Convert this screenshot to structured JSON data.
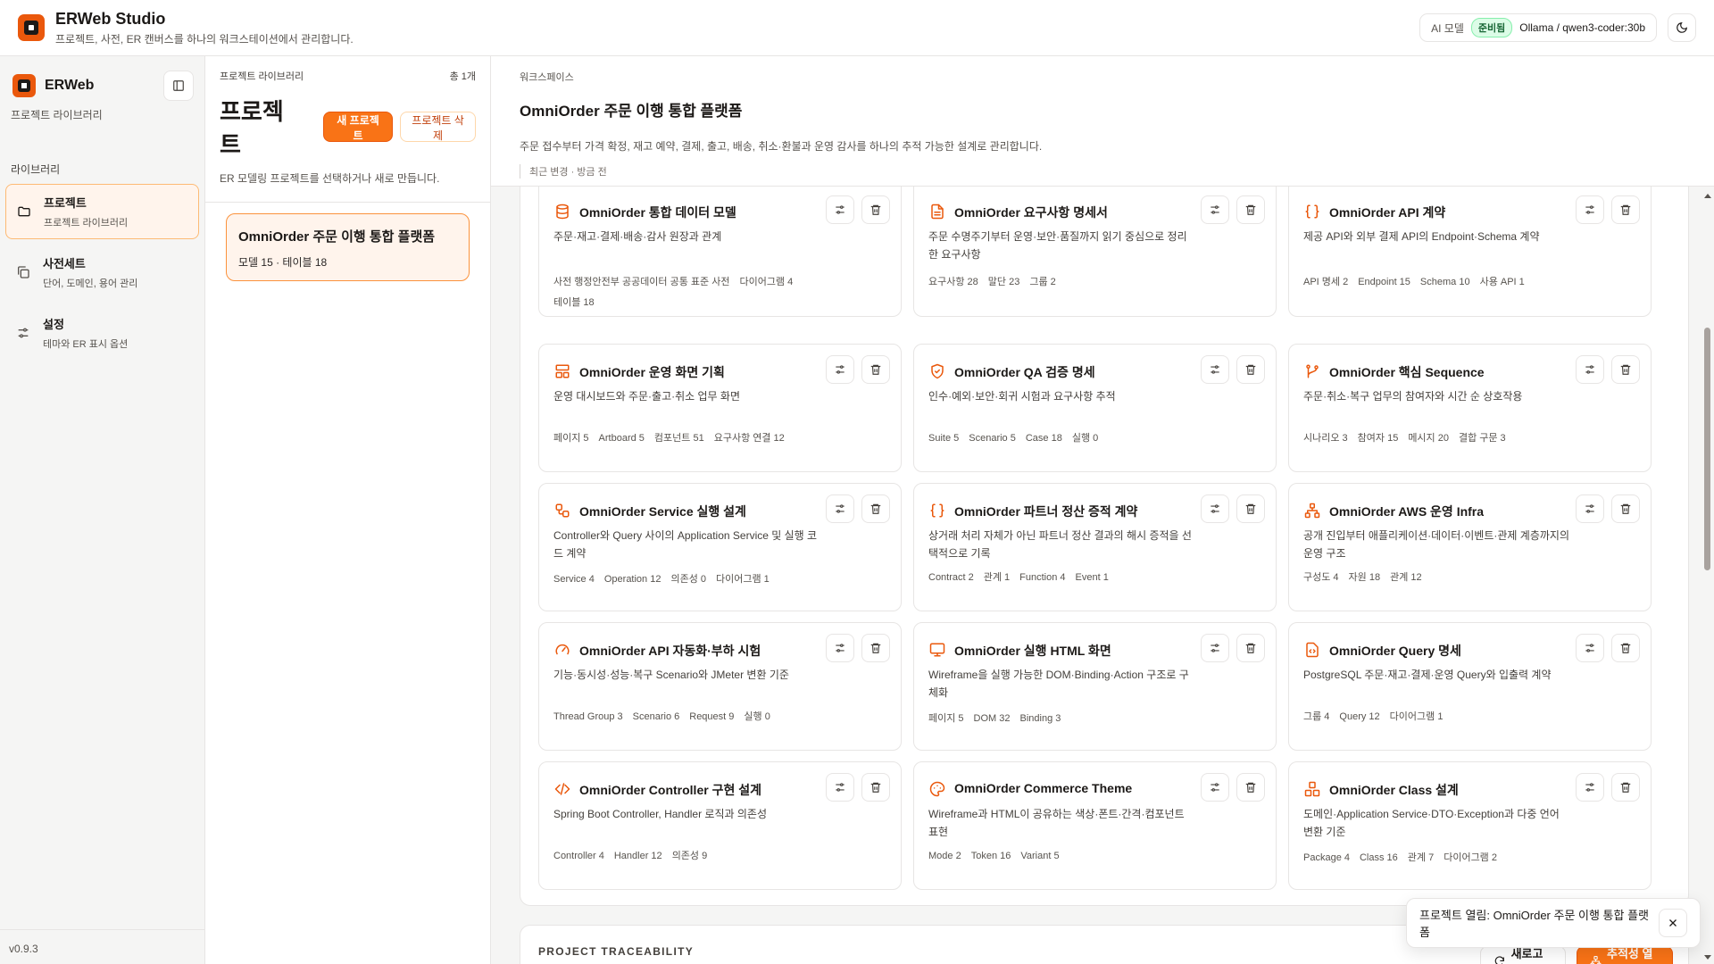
{
  "topbar": {
    "title": "ERWeb Studio",
    "subtitle": "프로젝트, 사전, ER 캔버스를 하나의 워크스테이션에서 관리합니다.",
    "ai_label": "AI 모델",
    "ai_status": "준비됨",
    "ai_model": "Ollama / qwen3-coder:30b"
  },
  "sidebar": {
    "brand": "ERWeb",
    "subtitle": "프로젝트 라이브러리",
    "section": "라이브러리",
    "items": [
      {
        "label": "프로젝트",
        "desc": "프로젝트 라이브러리",
        "active": true,
        "icon": "folder-icon"
      },
      {
        "label": "사전세트",
        "desc": "단어, 도메인, 용어 관리",
        "active": false,
        "icon": "copy-icon"
      },
      {
        "label": "설정",
        "desc": "테마와 ER 표시 옵션",
        "active": false,
        "icon": "sliders-icon"
      }
    ],
    "version": "v0.9.3"
  },
  "library": {
    "kicker": "프로젝트 라이브러리",
    "count": "총 1개",
    "title": "프로젝트",
    "new_button": "새 프로젝트",
    "delete_button": "프로젝트 삭제",
    "desc": "ER 모델링 프로젝트를 선택하거나 새로 만듭니다.",
    "projects": [
      {
        "name": "OmniOrder 주문 이행 통합 플랫폼",
        "meta": "모델 15 · 테이블 18"
      }
    ]
  },
  "workspace": {
    "kicker": "워크스페이스",
    "title": "OmniOrder 주문 이행 통합 플랫폼",
    "desc": "주문 접수부터 가격 확정, 재고 예약, 결제, 출고, 배송, 취소·환불과 운영 감사를 하나의 추적 가능한 설계로 관리합니다.",
    "meta": "최근 변경 · 방금 전",
    "cards": [
      {
        "icon": "database-icon",
        "title": "OmniOrder 통합 데이터 모델",
        "desc": "주문·재고·결제·배송·감사 원장과 관계",
        "stats": [
          "사전 행정안전부 공공데이터 공통 표준 사전",
          "다이어그램 4",
          "테이블 18"
        ]
      },
      {
        "icon": "document-icon",
        "title": "OmniOrder 요구사항 명세서",
        "desc": "주문 수명주기부터 운영·보안·품질까지 읽기 중심으로 정리한 요구사항",
        "stats": [
          "요구사항 28",
          "말단 23",
          "그룹 2"
        ]
      },
      {
        "icon": "braces-icon",
        "title": "OmniOrder API 계약",
        "desc": "제공 API와 외부 결제 API의 Endpoint·Schema 계약",
        "stats": [
          "API 명세 2",
          "Endpoint 15",
          "Schema 10",
          "사용 API 1"
        ]
      },
      {
        "icon": "layout-icon",
        "title": "OmniOrder 운영 화면 기획",
        "desc": "운영 대시보드와 주문·출고·취소 업무 화면",
        "stats": [
          "페이지 5",
          "Artboard 5",
          "컴포넌트 51",
          "요구사항 연결 12"
        ]
      },
      {
        "icon": "shield-check-icon",
        "title": "OmniOrder QA 검증 명세",
        "desc": "인수·예외·보안·회귀 시험과 요구사항 추적",
        "stats": [
          "Suite 5",
          "Scenario 5",
          "Case 18",
          "실행 0"
        ]
      },
      {
        "icon": "git-branch-icon",
        "title": "OmniOrder 핵심 Sequence",
        "desc": "주문·취소·복구 업무의 참여자와 시간 순 상호작용",
        "stats": [
          "시나리오 3",
          "참여자 15",
          "메시지 20",
          "결합 구문 3"
        ]
      },
      {
        "icon": "workflow-icon",
        "title": "OmniOrder Service 실행 설계",
        "desc": "Controller와 Query 사이의 Application Service 및 실행 코드 계약",
        "stats": [
          "Service 4",
          "Operation 12",
          "의존성 0",
          "다이어그램 1"
        ]
      },
      {
        "icon": "braces-icon",
        "title": "OmniOrder 파트너 정산 증적 계약",
        "desc": "상거래 처리 자체가 아닌 파트너 정산 결과의 해시 증적을 선택적으로 기록",
        "stats": [
          "Contract 2",
          "관계 1",
          "Function 4",
          "Event 1"
        ]
      },
      {
        "icon": "network-icon",
        "title": "OmniOrder AWS 운영 Infra",
        "desc": "공개 진입부터 애플리케이션·데이터·이벤트·관제 계층까지의 운영 구조",
        "stats": [
          "구성도 4",
          "자원 18",
          "관계 12"
        ]
      },
      {
        "icon": "gauge-icon",
        "title": "OmniOrder API 자동화·부하 시험",
        "desc": "기능·동시성·성능·복구 Scenario와 JMeter 변환 기준",
        "stats": [
          "Thread Group 3",
          "Scenario 6",
          "Request 9",
          "실행 0"
        ]
      },
      {
        "icon": "monitor-icon",
        "title": "OmniOrder 실행 HTML 화면",
        "desc": "Wireframe을 실행 가능한 DOM·Binding·Action 구조로 구체화",
        "stats": [
          "페이지 5",
          "DOM 32",
          "Binding 3"
        ]
      },
      {
        "icon": "file-code-icon",
        "title": "OmniOrder Query 명세",
        "desc": "PostgreSQL 주문·재고·결제·운영 Query와 입출력 계약",
        "stats": [
          "그룹 4",
          "Query 12",
          "다이어그램 1"
        ]
      },
      {
        "icon": "code-icon",
        "title": "OmniOrder Controller 구현 설계",
        "desc": "Spring Boot Controller, Handler 로직과 의존성",
        "stats": [
          "Controller 4",
          "Handler 12",
          "의존성 9"
        ]
      },
      {
        "icon": "palette-icon",
        "title": "OmniOrder Commerce Theme",
        "desc": "Wireframe과 HTML이 공유하는 색상·폰트·간격·컴포넌트 표현",
        "stats": [
          "Mode 2",
          "Token 16",
          "Variant 5"
        ]
      },
      {
        "icon": "boxes-icon",
        "title": "OmniOrder Class 설계",
        "desc": "도메인·Application Service·DTO·Exception과 다중 언어 변환 기준",
        "stats": [
          "Package 4",
          "Class 16",
          "관계 7",
          "다이어그램 2"
        ]
      }
    ],
    "traceability": {
      "label": "PROJECT TRACEABILITY",
      "refresh": "새로고침",
      "open": "추적성 열기"
    }
  },
  "toast": {
    "message": "프로젝트 열림: OmniOrder 주문 이행 통합 플랫폼"
  },
  "colors": {
    "accent": "#f97316",
    "accent_dark": "#ea580c",
    "ready_bg": "#dcfce7",
    "active_bg": "#fff4ec"
  }
}
